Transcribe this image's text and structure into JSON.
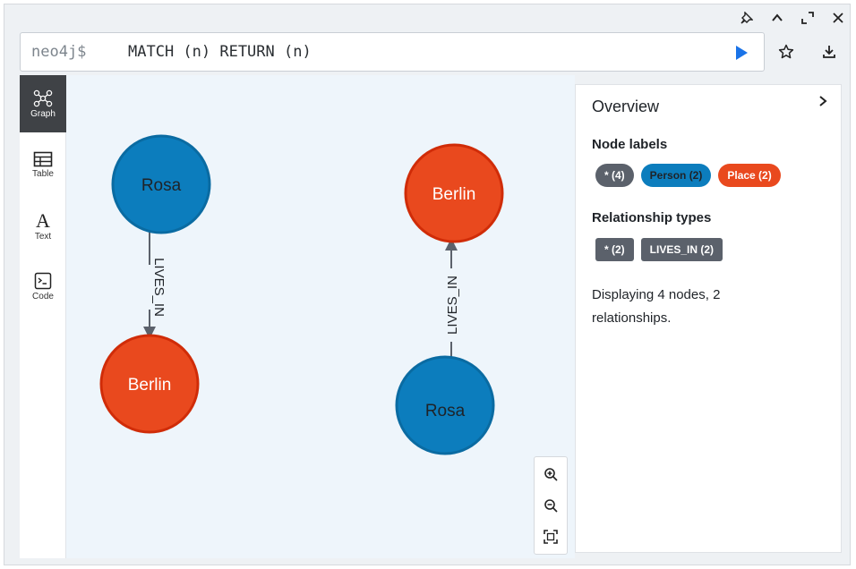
{
  "window": {
    "controls": [
      {
        "name": "pin-icon",
        "glyph": "✎"
      },
      {
        "name": "chevron-up-icon",
        "glyph": "⌃"
      },
      {
        "name": "expand-icon",
        "glyph": "⤢"
      },
      {
        "name": "close-icon",
        "glyph": "✕"
      }
    ]
  },
  "editor": {
    "prompt": "neo4j$",
    "query": "MATCH (n) RETURN (n)"
  },
  "rail": {
    "items": [
      {
        "label": "Graph",
        "icon": "graph-icon",
        "active": true
      },
      {
        "label": "Table",
        "icon": "table-icon",
        "active": false
      },
      {
        "label": "Text",
        "icon": "text-icon",
        "active": false
      },
      {
        "label": "Code",
        "icon": "code-icon",
        "active": false
      }
    ]
  },
  "graph": {
    "nodes": [
      {
        "label": "Rosa",
        "type": "Person",
        "color": "#0c7dbd",
        "stroke": "#0a6ba2"
      },
      {
        "label": "Berlin",
        "type": "Place",
        "color": "#e9491e",
        "stroke": "#d02c08"
      },
      {
        "label": "Berlin",
        "type": "Place",
        "color": "#e9491e",
        "stroke": "#d02c08"
      },
      {
        "label": "Rosa",
        "type": "Person",
        "color": "#0c7dbd",
        "stroke": "#0a6ba2"
      }
    ],
    "relationships": [
      {
        "from": 0,
        "to": 1,
        "type": "LIVES_IN"
      },
      {
        "from": 3,
        "to": 2,
        "type": "LIVES_IN"
      }
    ]
  },
  "overview": {
    "title": "Overview",
    "node_labels_heading": "Node labels",
    "node_labels": [
      {
        "text": "* (4)",
        "color": "#5b616b"
      },
      {
        "text": "Person (2)",
        "color": "#0c7dbd",
        "text_color": "#1f2328"
      },
      {
        "text": "Place (2)",
        "color": "#e9491e"
      }
    ],
    "rel_types_heading": "Relationship types",
    "rel_types": [
      {
        "text": "* (2)",
        "color": "#5b616b"
      },
      {
        "text": "LIVES_IN (2)",
        "color": "#5b616b"
      }
    ],
    "summary": "Displaying 4 nodes, 2 relationships."
  }
}
